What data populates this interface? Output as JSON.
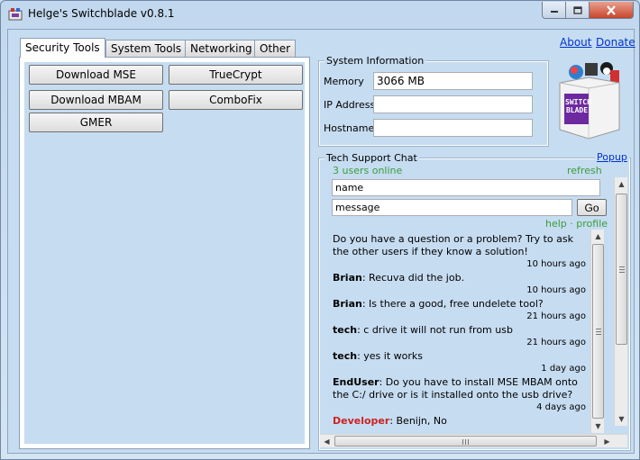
{
  "window": {
    "title": "Helge's Switchblade v0.8.1"
  },
  "tabs": [
    {
      "label": "Security Tools",
      "active": true
    },
    {
      "label": "System Tools",
      "active": false
    },
    {
      "label": "Networking",
      "active": false
    },
    {
      "label": "Other",
      "active": false
    }
  ],
  "tools": [
    "Download MSE",
    "TrueCrypt",
    "Download MBAM",
    "ComboFix",
    "GMER"
  ],
  "links": {
    "about": "About",
    "donate": "Donate"
  },
  "system_info": {
    "title": "System Information",
    "memory_label": "Memory",
    "memory_value": "3066 MB",
    "ip_label": "IP Address",
    "ip_value": "",
    "hostname_label": "Hostname",
    "hostname_value": ""
  },
  "logo_text": "SWITCH BLADE",
  "chat": {
    "title": "Tech Support Chat",
    "popup": "Popup",
    "users_online": "3 users online",
    "refresh": "refresh",
    "name_value": "name",
    "message_value": "message",
    "go_label": "Go",
    "help_profile": "help · profile",
    "messages": [
      {
        "user": "",
        "text": "Do you have a question or a problem? Try to ask the other users if they know a solution!",
        "time": "10 hours ago"
      },
      {
        "user": "Brian",
        "text": ": Recuva did the job.",
        "time": "10 hours ago"
      },
      {
        "user": "Brian",
        "text": ": Is there a good, free undelete tool?",
        "time": "21 hours ago"
      },
      {
        "user": "tech",
        "text": ": c drive it will not run from usb",
        "time": "21 hours ago"
      },
      {
        "user": "tech",
        "text": ": yes it works",
        "time": "1 day ago"
      },
      {
        "user": "EndUser",
        "text": ": Do you have to install MSE MBAM onto the C:/ drive or is it installed onto the usb drive?",
        "time": "4 days ago"
      },
      {
        "user": "Developer",
        "text": ": Benijn, No",
        "time": "",
        "developer": true
      }
    ]
  },
  "colors": {
    "accent_link": "#0033cc",
    "online_green": "#3a9d3a",
    "developer_red": "#cc2222"
  }
}
